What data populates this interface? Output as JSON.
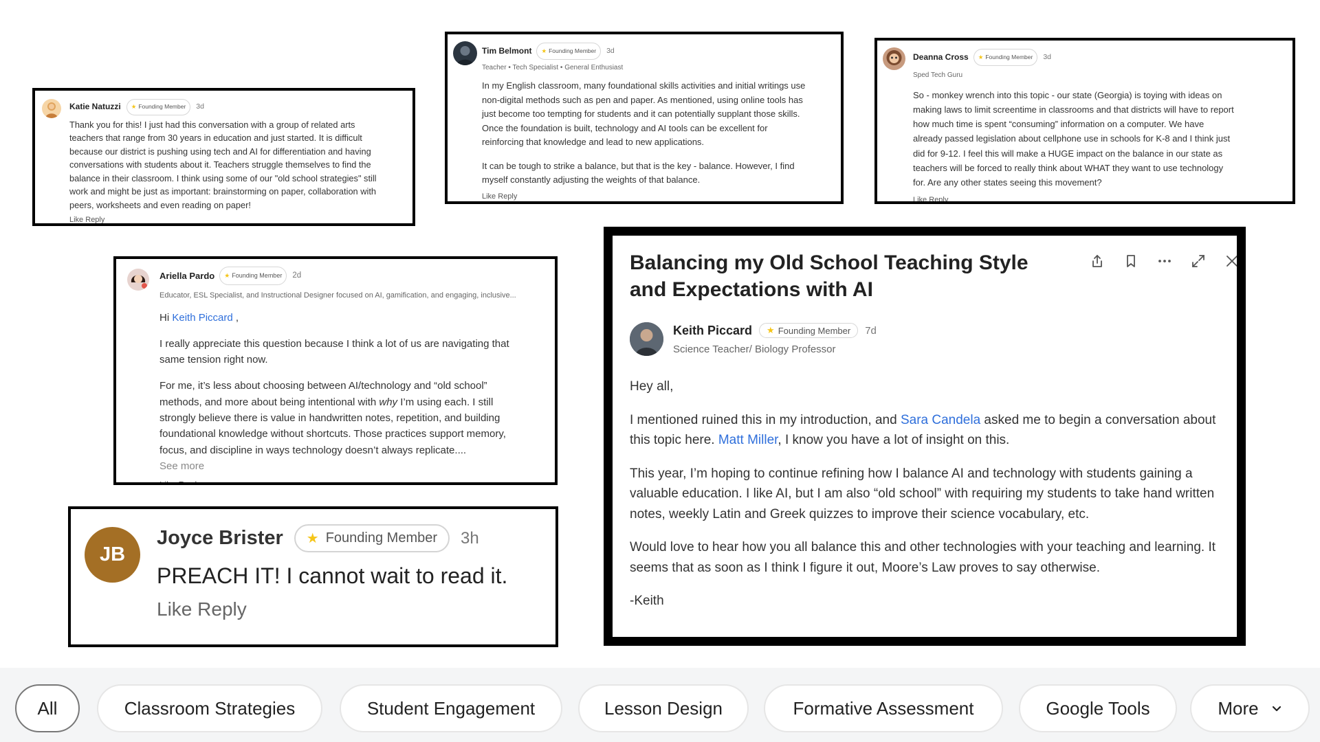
{
  "badge_label": "Founding Member",
  "like_label": "Like",
  "reply_label": "Reply",
  "comments": {
    "katie": {
      "name": "Katie Natuzzi",
      "time": "3d",
      "lines": [
        "Thank you for this! I just had this conversation with a group of related arts",
        "teachers that range from 30 years in education and just started. It is difficult",
        "because our district is pushing using tech and AI for differentiation and having",
        "conversations with students about it. Teachers struggle themselves to find the",
        "balance in their classroom. I think using some of our \"old school strategies\" still",
        "work and might be just as important: brainstorming on paper, collaboration with",
        "peers, worksheets and even reading on paper!"
      ]
    },
    "tim": {
      "name": "Tim Belmont",
      "time": "3d",
      "subtitle": "Teacher • Tech Specialist • General Enthusiast",
      "p1_lines": [
        "In my English classroom, many foundational skills activities and initial writings use",
        "non-digital methods such as pen and paper. As mentioned, using online tools has",
        "just become too tempting for students and it can potentially supplant those skills.",
        "Once the foundation is built, technology and AI tools can be excellent for",
        "reinforcing that knowledge and lead to new applications."
      ],
      "p2_lines": [
        "It can be tough to strike a balance, but that is the key - balance. However, I find",
        "myself constantly adjusting the weights of that balance."
      ]
    },
    "deanna": {
      "name": "Deanna Cross",
      "time": "3d",
      "subtitle": "Sped Tech Guru",
      "lines": [
        "So - monkey wrench into this topic - our state (Georgia) is toying with ideas on",
        "making laws to limit screentime in classrooms and that districts will have to report",
        "how much time is spent “consuming” information on a computer.  We have",
        "already passed legislation about cellphone use in schools for K-8 and I think just",
        "did for 9-12.  I feel this will make a HUGE impact on the balance in our state as",
        "teachers will be forced to really think about WHAT they want to use technology",
        "for.  Are any other states seeing this movement?"
      ]
    },
    "ariella": {
      "name": "Ariella Pardo",
      "time": "2d",
      "subtitle": "Educator, ESL Specialist, and Instructional Designer focused on AI, gamification, and engaging, inclusive...",
      "greeting": "Hi",
      "mention": "Keith Piccard",
      "greeting_end": ",",
      "p1_lines": [
        "I really appreciate this question because I think a lot of us are navigating that",
        "same tension right now."
      ],
      "p2_line1": "For me, it’s less about choosing between AI/technology and “old school”",
      "p2_line2_a": "methods, and more about being intentional with ",
      "p2_line2_em": "why",
      "p2_line2_b": " I’m using each. I still",
      "p2_rest": [
        "strongly believe there is value in handwritten notes, repetition, and building",
        "foundational knowledge without shortcuts. Those practices support memory,",
        "focus, and discipline in ways technology doesn’t always replicate...."
      ],
      "see_more": "See more"
    },
    "joyce": {
      "name": "Joyce Brister",
      "initials": "JB",
      "time": "3h",
      "text": "PREACH IT!  I cannot wait to read it."
    }
  },
  "post": {
    "title": "Balancing my Old School Teaching Style and Expectations with AI",
    "author": "Keith Piccard",
    "time": "7d",
    "subtitle": "Science Teacher/ Biology Professor",
    "greeting": "Hey all,",
    "p1_a": "I mentioned ruined this in my introduction, and ",
    "p1_link1": "Sara Candela",
    "p1_b": " asked me to begin a conversation about this topic here.  ",
    "p1_link2": "Matt Miller",
    "p1_c": ", I know you have a lot of insight on this.",
    "p2": "This year, I’m hoping to continue refining how I balance AI and technology with students gaining a valuable education.  I like AI, but I am also “old school” with requiring my students to take hand written notes, weekly Latin and Greek quizzes to improve their science vocabulary, etc.",
    "p3": "Would love to hear how you all balance this and other technologies with your teaching and learning.  It seems that as soon as I think I figure it out, Moore’s Law proves to say otherwise.",
    "signoff": "-Keith",
    "tool_icons": [
      "share-icon",
      "bookmark-icon",
      "more-icon",
      "expand-icon",
      "close-icon"
    ]
  },
  "filters": {
    "items": [
      "All",
      "Classroom Strategies",
      "Student Engagement",
      "Lesson Design",
      "Formative Assessment",
      "Google Tools"
    ],
    "more": "More",
    "active": "All"
  },
  "colors": {
    "link": "#2f6fdb",
    "badge_star": "#f5c518",
    "joyce_avatar": "#a46f25",
    "filter_bar_bg": "#f4f5f6"
  }
}
